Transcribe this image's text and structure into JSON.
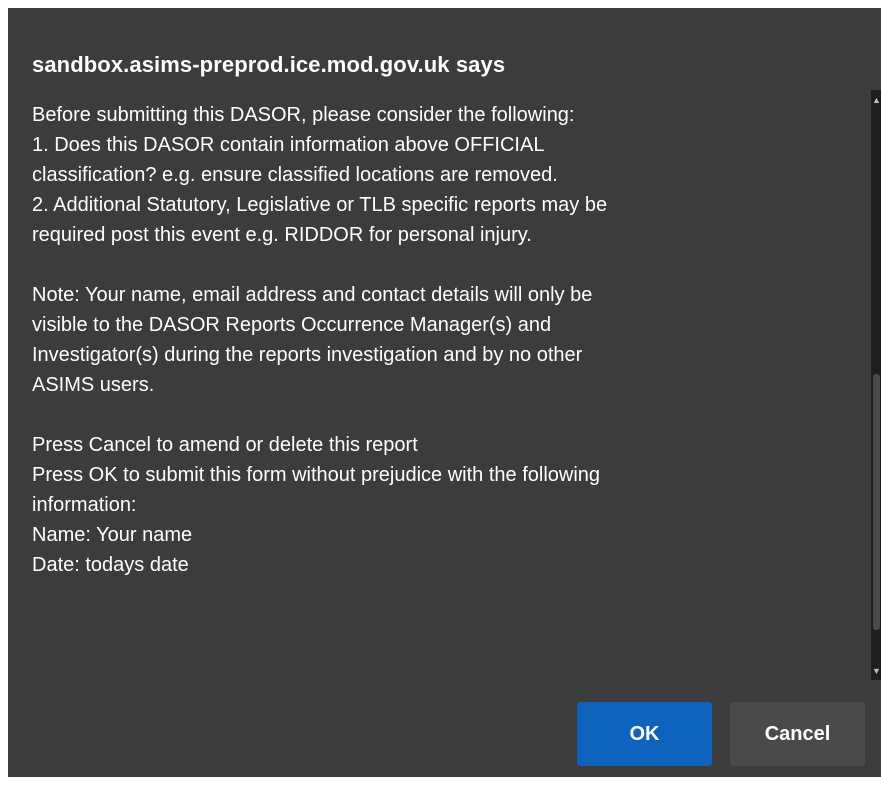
{
  "dialog": {
    "title": "sandbox.asims-preprod.ice.mod.gov.uk says",
    "message_lines": [
      "Before submitting this DASOR, please consider the following:",
      "1. Does this DASOR contain information above OFFICIAL",
      "classification? e.g. ensure classified locations are removed.",
      "2. Additional Statutory, Legislative or TLB specific reports may be",
      "required post this event e.g. RIDDOR for personal injury.",
      "",
      "Note: Your name, email address and contact details will only be",
      "visible to the DASOR Reports Occurrence Manager(s) and",
      "Investigator(s) during the reports investigation and by no other",
      "ASIMS users.",
      "",
      "Press Cancel to amend or delete this report",
      "Press OK to submit this form without prejudice with the following",
      "information:",
      "Name: Your name",
      "Date: todays date"
    ],
    "ok_label": "OK",
    "cancel_label": "Cancel"
  },
  "colors": {
    "dialog_background": "#3c3c3c",
    "ok_button": "#0e63be",
    "cancel_button": "#4a4a4a",
    "text": "#ffffff"
  },
  "icons": {
    "scroll_up": "chevron-up-icon",
    "scroll_down": "chevron-down-icon"
  }
}
